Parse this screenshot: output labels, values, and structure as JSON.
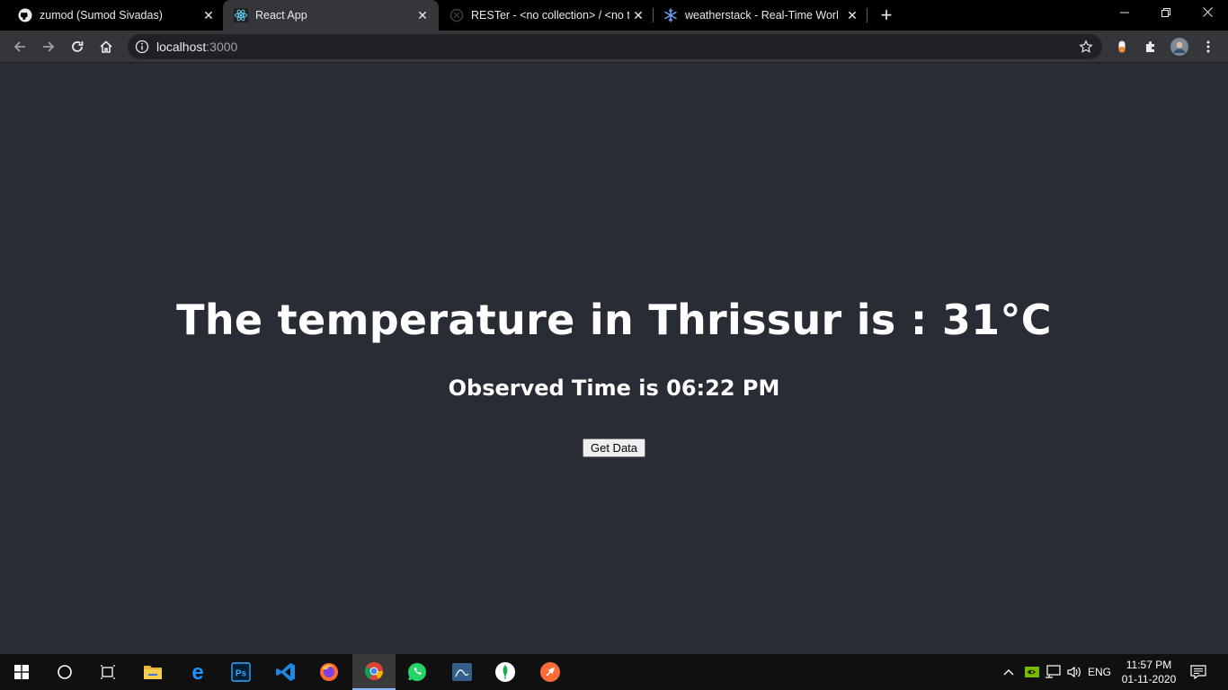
{
  "browser": {
    "tabs": [
      {
        "title": "zumod (Sumod Sivadas)",
        "icon": "github-icon"
      },
      {
        "title": "React App",
        "icon": "react-icon",
        "active": true
      },
      {
        "title": "RESTer - <no collection> / <no ti",
        "icon": "rester-icon"
      },
      {
        "title": "weatherstack - Real-Time World \\",
        "icon": "weatherstack-icon"
      }
    ],
    "url_host": "localhost",
    "url_port": ":3000"
  },
  "page": {
    "headline": "The temperature in Thrissur is : 31°C",
    "observed": "Observed Time is 06:22 PM",
    "button_label": "Get Data"
  },
  "taskbar": {
    "language": "ENG",
    "time": "11:57 PM",
    "date": "01-11-2020"
  },
  "colors": {
    "page_background": "#282c34",
    "tabstrip": "#000000",
    "toolbar": "#35363a",
    "taskbar": "#101010"
  }
}
